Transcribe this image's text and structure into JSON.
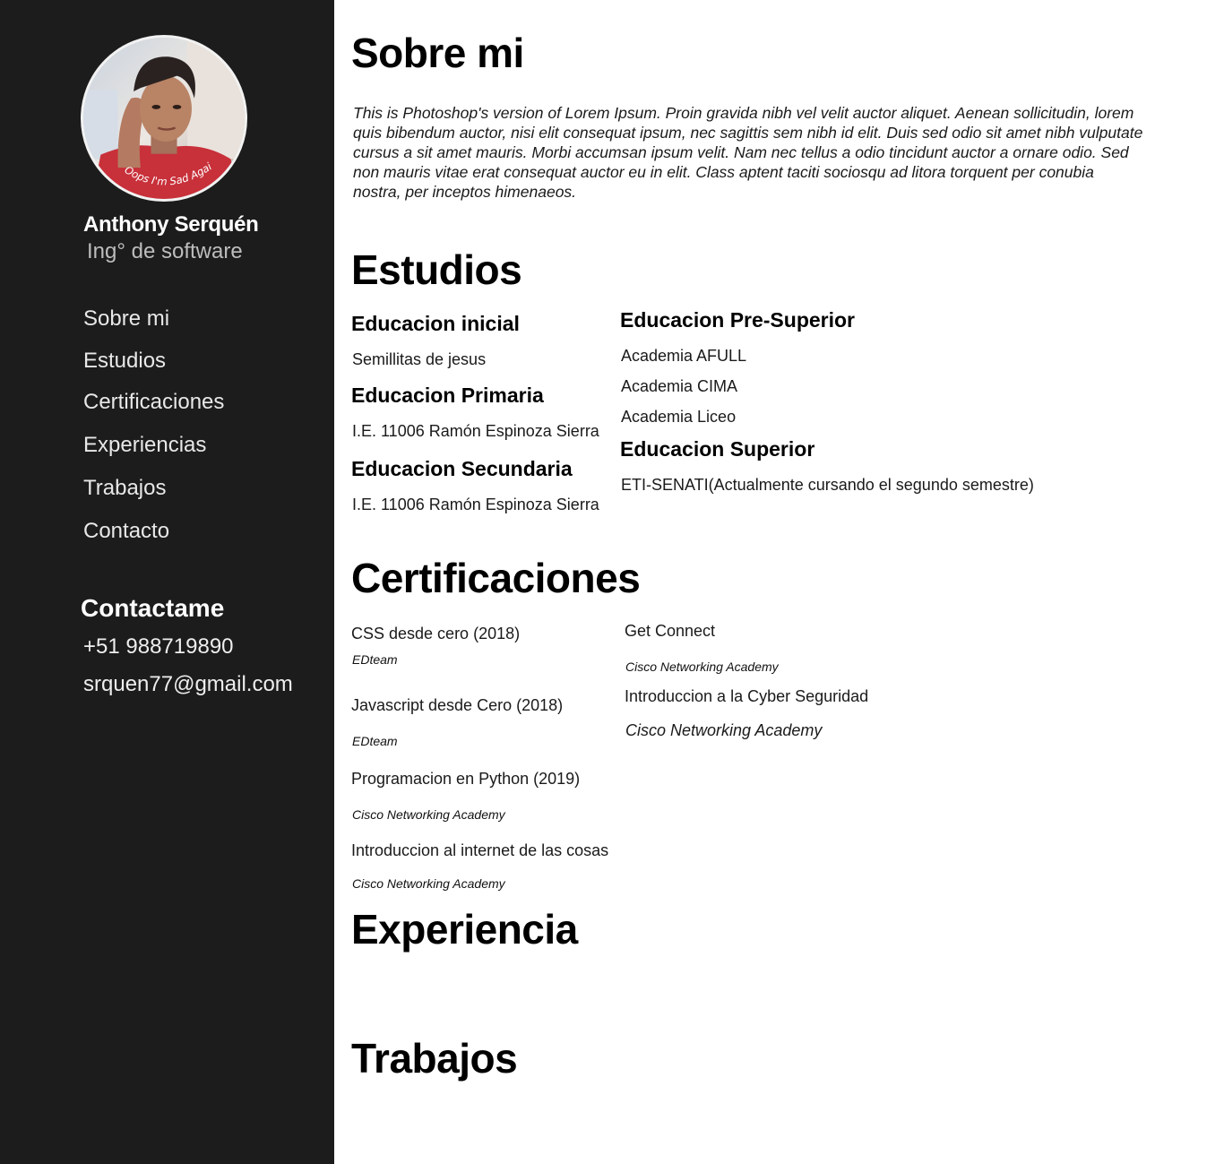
{
  "profile": {
    "name": "Anthony Serquén",
    "role": "Ing° de software",
    "photo_caption": "Oops I'm Sad Again"
  },
  "nav": {
    "items": [
      {
        "label": "Sobre mi"
      },
      {
        "label": "Estudios"
      },
      {
        "label": "Certificaciones"
      },
      {
        "label": "Experiencias"
      },
      {
        "label": "Trabajos"
      },
      {
        "label": "Contacto"
      }
    ]
  },
  "contact": {
    "title": "Contactame",
    "phone": "+51 988719890",
    "email": "srquen77@gmail.com"
  },
  "about": {
    "title": "Sobre mi",
    "text": "This is Photoshop's version  of Lorem Ipsum. Proin gravida nibh vel velit auctor aliquet. Aenean sollicitudin, lorem quis bibendum auctor, nisi elit consequat ipsum, nec sagittis sem nibh id elit. Duis sed odio sit amet nibh vulputate cursus a sit amet mauris. Morbi accumsan ipsum velit. Nam nec tellus a odio tincidunt auctor a ornare odio. Sed non  mauris vitae erat consequat auctor eu in elit. Class aptent taciti sociosqu ad litora torquent per conubia nostra, per inceptos himenaeos."
  },
  "studies": {
    "title": "Estudios",
    "left": [
      {
        "heading": "Educacion inicial",
        "items": [
          "Semillitas de jesus"
        ]
      },
      {
        "heading": "Educacion Primaria",
        "items": [
          "I.E. 11006 Ramón Espinoza Sierra"
        ]
      },
      {
        "heading": "Educacion Secundaria",
        "items": [
          "I.E. 11006 Ramón Espinoza Sierra"
        ]
      }
    ],
    "right": [
      {
        "heading": "Educacion Pre-Superior",
        "items": [
          "Academia AFULL",
          "Academia CIMA",
          "Academia Liceo"
        ]
      },
      {
        "heading": "Educacion Superior",
        "items": [
          "ETI-SENATI(Actualmente cursando el segundo semestre)"
        ]
      }
    ]
  },
  "certifications": {
    "title": "Certificaciones",
    "left": [
      {
        "name": "CSS desde cero (2018)",
        "issuer": "EDteam"
      },
      {
        "name": "Javascript desde Cero (2018)",
        "issuer": "EDteam"
      },
      {
        "name": "Programacion en Python (2019)",
        "issuer": "Cisco Networking Academy"
      },
      {
        "name": "Introduccion al internet de las cosas",
        "issuer": "Cisco Networking Academy"
      }
    ],
    "right": [
      {
        "name": "Get Connect",
        "issuer": "Cisco Networking Academy"
      },
      {
        "name": "Introduccion a la Cyber Seguridad",
        "issuer": "Cisco Networking Academy"
      }
    ]
  },
  "experience": {
    "title": "Experiencia"
  },
  "works": {
    "title": "Trabajos"
  },
  "colors": {
    "sidebar": "#1c1c1c",
    "main": "#ffffff",
    "text": "#000000"
  }
}
